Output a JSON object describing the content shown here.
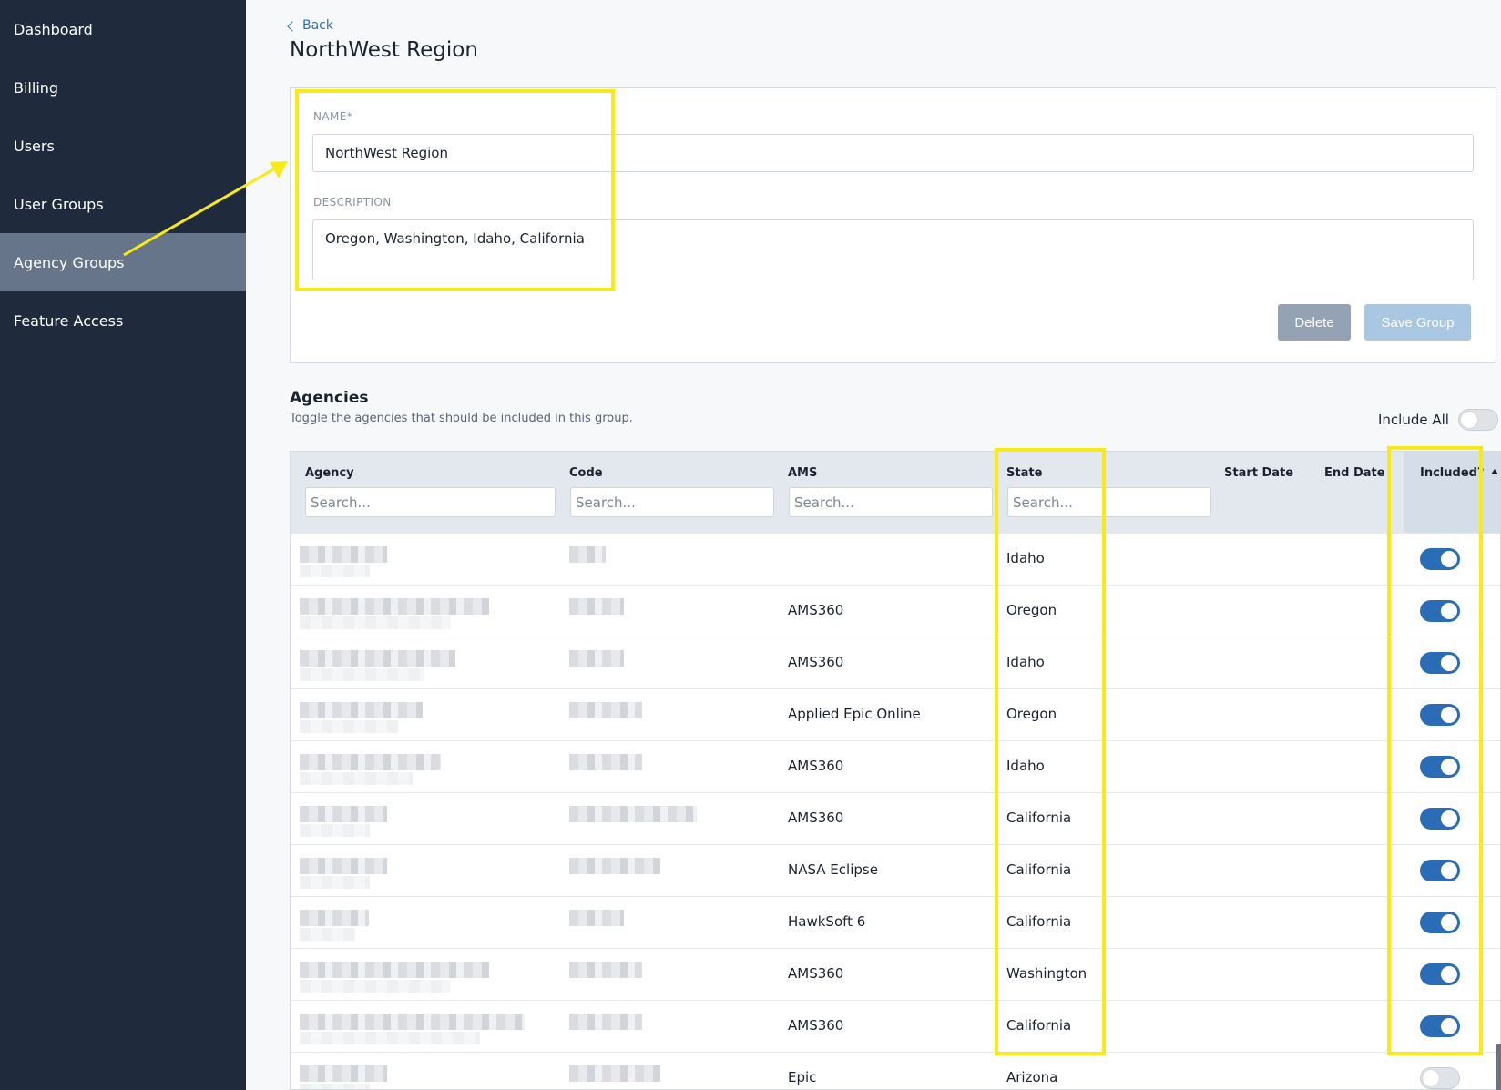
{
  "sidebar": {
    "items": [
      {
        "label": "Dashboard",
        "active": false
      },
      {
        "label": "Billing",
        "active": false
      },
      {
        "label": "Users",
        "active": false
      },
      {
        "label": "User Groups",
        "active": false
      },
      {
        "label": "Agency Groups",
        "active": true
      },
      {
        "label": "Feature Access",
        "active": false
      }
    ]
  },
  "header": {
    "back_label": "Back",
    "title": "NorthWest Region"
  },
  "form": {
    "name_label": "NAME*",
    "name_value": "NorthWest Region",
    "description_label": "DESCRIPTION",
    "description_value": "Oregon, Washington, Idaho, California",
    "delete_label": "Delete",
    "save_label": "Save Group"
  },
  "agencies": {
    "title": "Agencies",
    "subtitle": "Toggle the agencies that should be included in this group.",
    "include_all_label": "Include All",
    "include_all_on": false,
    "columns": {
      "agency": "Agency",
      "code": "Code",
      "ams": "AMS",
      "state": "State",
      "start_date": "Start Date",
      "end_date": "End Date",
      "included": "Included?"
    },
    "search_placeholder": "Search...",
    "rows": [
      {
        "ams": "",
        "state": "Idaho",
        "included": true
      },
      {
        "ams": "AMS360",
        "state": "Oregon",
        "included": true
      },
      {
        "ams": "AMS360",
        "state": "Idaho",
        "included": true
      },
      {
        "ams": "Applied Epic Online",
        "state": "Oregon",
        "included": true
      },
      {
        "ams": "AMS360",
        "state": "Idaho",
        "included": true
      },
      {
        "ams": "AMS360",
        "state": "California",
        "included": true
      },
      {
        "ams": "NASA Eclipse",
        "state": "California",
        "included": true
      },
      {
        "ams": "HawkSoft 6",
        "state": "California",
        "included": true
      },
      {
        "ams": "AMS360",
        "state": "Washington",
        "included": true
      },
      {
        "ams": "AMS360",
        "state": "California",
        "included": true
      },
      {
        "ams": "Epic",
        "state": "Arizona",
        "included": false
      }
    ]
  },
  "colors": {
    "sidebar_bg": "#1f2a3c",
    "sidebar_active": "#66758a",
    "toggle_on": "#2a6db6",
    "annotation": "#f7ea16"
  }
}
